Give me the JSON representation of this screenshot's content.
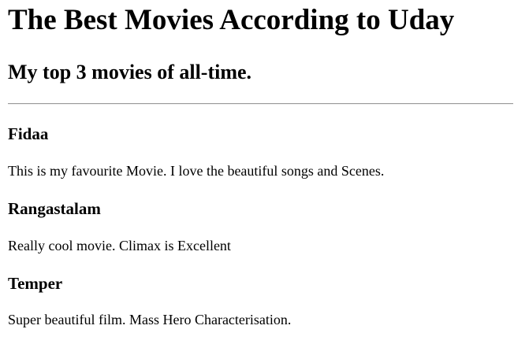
{
  "page": {
    "title": "The Best Movies According to Uday",
    "subtitle": "My top 3 movies of all-time."
  },
  "movies": [
    {
      "name": "Fidaa",
      "description": "This is my favourite Movie. I love the beautiful songs and Scenes."
    },
    {
      "name": "Rangastalam",
      "description": "Really cool movie. Climax is Excellent"
    },
    {
      "name": "Temper",
      "description": "Super beautiful film. Mass Hero Characterisation."
    }
  ]
}
